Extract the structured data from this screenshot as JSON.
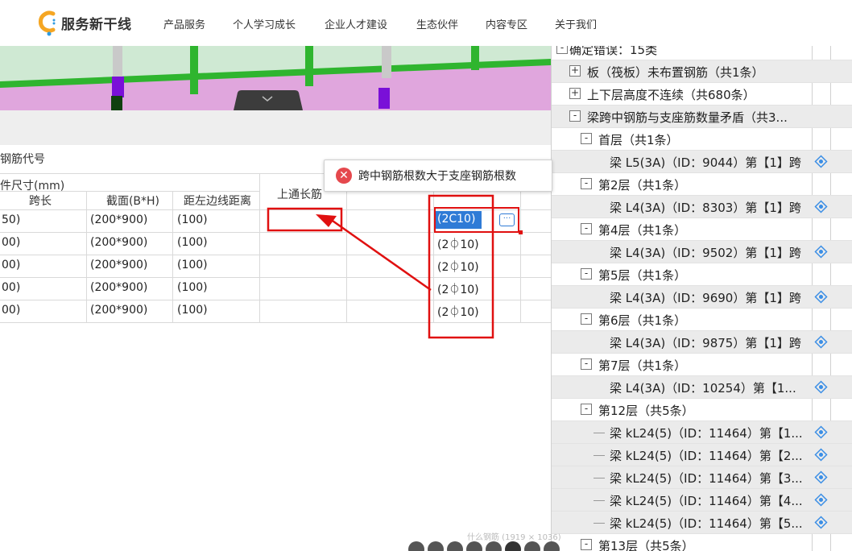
{
  "nav": {
    "brand": "服务新干线",
    "items": [
      "产品服务",
      "个人学习成长",
      "企业人才建设",
      "生态伙伴",
      "内容专区",
      "关于我们"
    ]
  },
  "table": {
    "title": "钢筋代号",
    "group_header": "件尺寸(mm)",
    "headers": {
      "span": "跨长",
      "section": "截面(B*H)",
      "edge": "距左边线距离",
      "top_long": "上通长筋"
    },
    "rows": [
      {
        "span": "50)",
        "section": "(200*900)",
        "edge": "(100)"
      },
      {
        "span": "00)",
        "section": "(200*900)",
        "edge": "(100)"
      },
      {
        "span": "00)",
        "section": "(200*900)",
        "edge": "(100)"
      },
      {
        "span": "00)",
        "section": "(200*900)",
        "edge": "(100)"
      },
      {
        "span": "00)",
        "section": "(200*900)",
        "edge": "(100)"
      }
    ],
    "selected_value": "(2C10)",
    "rebar_values": [
      "(2⏀10)",
      "(2⏀10)",
      "(2⏀10)",
      "(2⏀10)"
    ],
    "ellipsis": "···"
  },
  "tooltip": {
    "message": "跨中钢筋根数大于支座钢筋根数"
  },
  "tree": {
    "header": "确定错误：15类",
    "items": [
      {
        "label": "板（筏板）未布置钢筋（共1条）",
        "toggle": "+",
        "level": 1,
        "shade": true
      },
      {
        "label": "上下层高度不连续（共680条）",
        "toggle": "+",
        "level": 1,
        "shade": false
      },
      {
        "label": "梁跨中钢筋与支座筋数量矛盾（共3...",
        "toggle": "-",
        "level": 1,
        "shade": true
      },
      {
        "label": "首层（共1条）",
        "toggle": "-",
        "level": 2,
        "shade": false
      },
      {
        "label": "梁 L5(3A)（ID：9044）第【1】跨",
        "toggle": "",
        "level": 3,
        "shade": true
      },
      {
        "label": "第2层（共1条）",
        "toggle": "-",
        "level": 2,
        "shade": false
      },
      {
        "label": "梁 L4(3A)（ID：8303）第【1】跨",
        "toggle": "",
        "level": 3,
        "shade": true
      },
      {
        "label": "第4层（共1条）",
        "toggle": "-",
        "level": 2,
        "shade": false
      },
      {
        "label": "梁 L4(3A)（ID：9502）第【1】跨",
        "toggle": "",
        "level": 3,
        "shade": true
      },
      {
        "label": "第5层（共1条）",
        "toggle": "-",
        "level": 2,
        "shade": false
      },
      {
        "label": "梁 L4(3A)（ID：9690）第【1】跨",
        "toggle": "",
        "level": 3,
        "shade": true
      },
      {
        "label": "第6层（共1条）",
        "toggle": "-",
        "level": 2,
        "shade": false
      },
      {
        "label": "梁 L4(3A)（ID：9875）第【1】跨",
        "toggle": "",
        "level": 3,
        "shade": true
      },
      {
        "label": "第7层（共1条）",
        "toggle": "-",
        "level": 2,
        "shade": false
      },
      {
        "label": "梁 L4(3A)（ID：10254）第【1...",
        "toggle": "",
        "level": 3,
        "shade": true
      },
      {
        "label": "第12层（共5条）",
        "toggle": "-",
        "level": 2,
        "shade": false
      },
      {
        "label": "梁 kL24(5)（ID：11464）第【1...",
        "toggle": "",
        "level": 3,
        "shade": true
      },
      {
        "label": "梁 kL24(5)（ID：11464）第【2...",
        "toggle": "",
        "level": 3,
        "shade": true
      },
      {
        "label": "梁 kL24(5)（ID：11464）第【3...",
        "toggle": "",
        "level": 3,
        "shade": true
      },
      {
        "label": "梁 kL24(5)（ID：11464）第【4...",
        "toggle": "",
        "level": 3,
        "shade": true
      },
      {
        "label": "梁 kL24(5)（ID：11464）第【5...",
        "toggle": "",
        "level": 3,
        "shade": true
      },
      {
        "label": "第13层（共5条）",
        "toggle": "-",
        "level": 2,
        "shade": false
      }
    ]
  },
  "watermark": "什么钢筋 (1919 × 1036)",
  "colors": {
    "accent": "#2f7bd6",
    "annotation_red": "#e01010",
    "error_red": "#e5484d",
    "drawing_green": "#2fb52f",
    "drawing_bg": "#cfe9d3",
    "drawing_pink": "#e0a6dd",
    "locate_icon": "#3a8ee6"
  }
}
